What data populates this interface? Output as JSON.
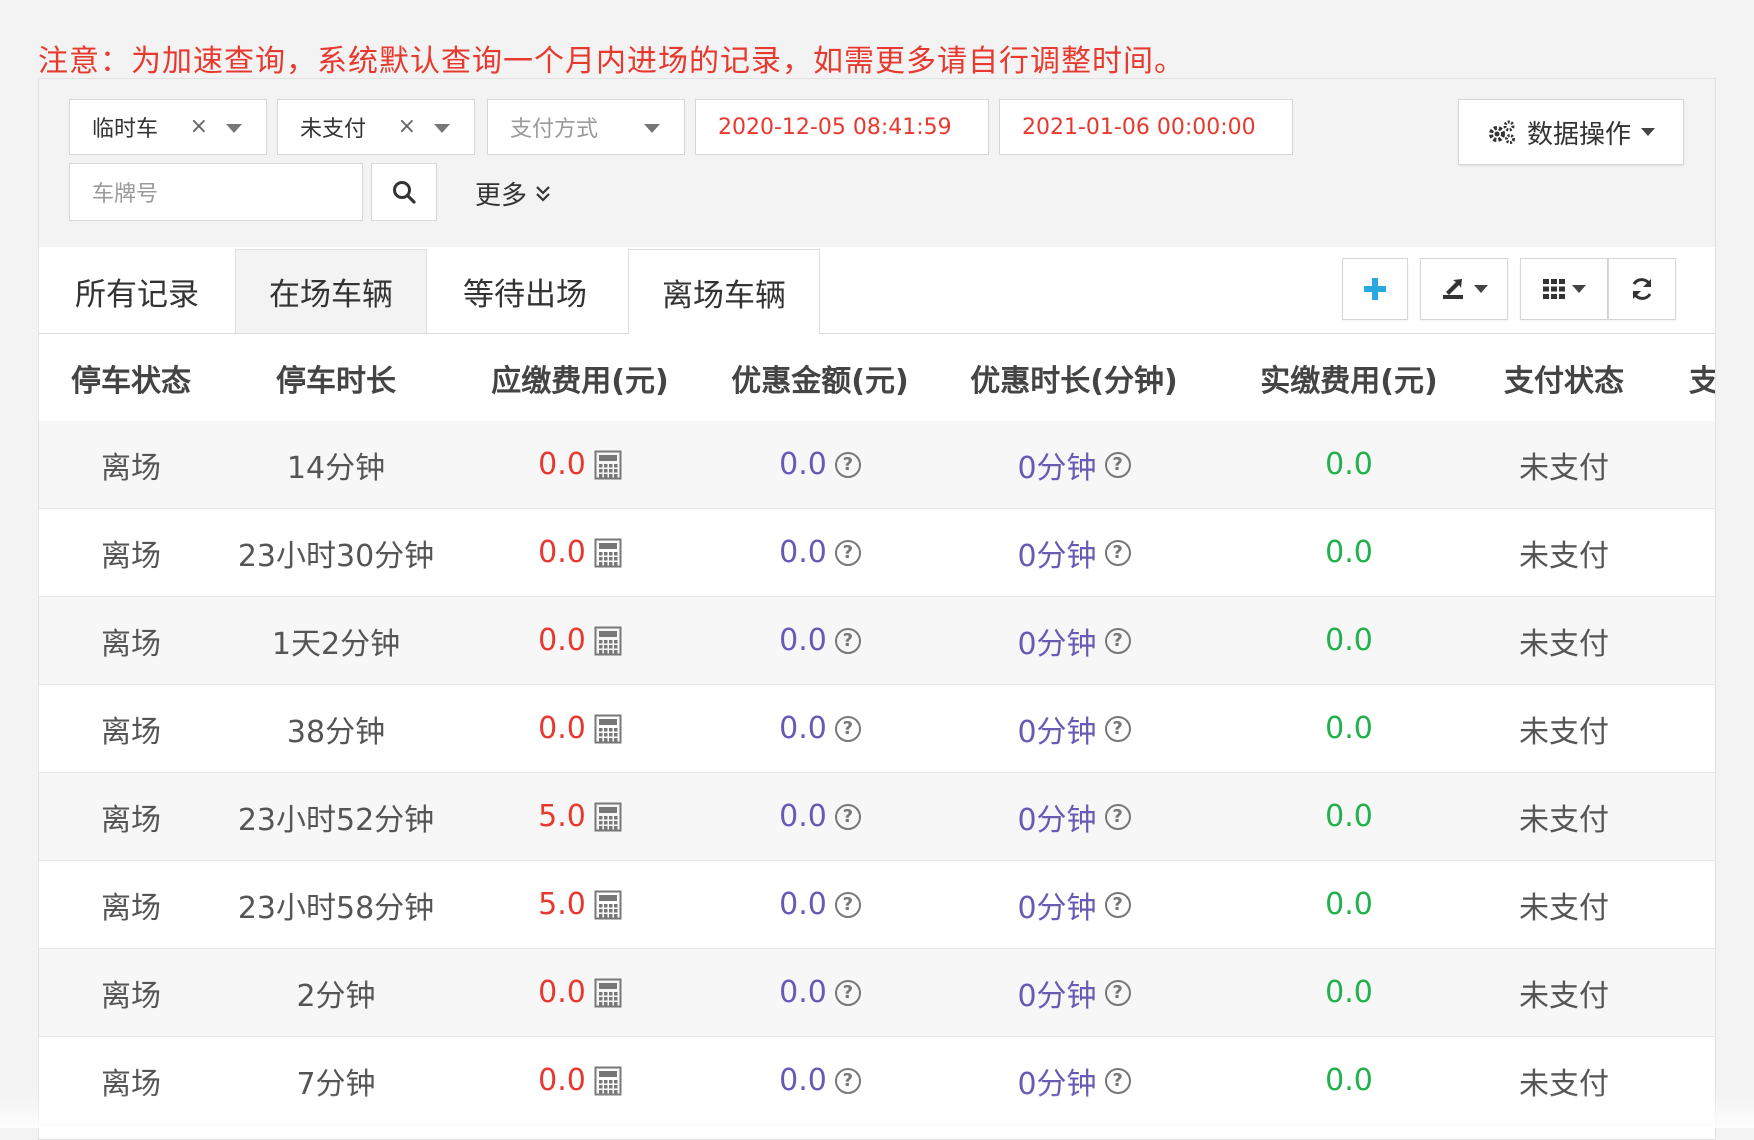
{
  "notice": "注意：为加速查询，系统默认查询一个月内进场的记录，如需更多请自行调整时间。",
  "filters": {
    "car_type": {
      "value": "临时车",
      "clear": "×"
    },
    "pay_status": {
      "value": "未支付",
      "clear": "×"
    },
    "pay_method": {
      "placeholder": "支付方式"
    },
    "start_time": "2020-12-05 08:41:59",
    "end_time": "2021-01-06 00:00:00",
    "plate_placeholder": "车牌号",
    "more_label": "更多"
  },
  "data_ops_label": "数据操作",
  "tabs": [
    "所有记录",
    "在场车辆",
    "等待出场",
    "离场车辆"
  ],
  "columns": [
    "停车状态",
    "停车时长",
    "应缴费用(元)",
    "优惠金额(元)",
    "优惠时长(分钟)",
    "实缴费用(元)",
    "支付状态",
    "支"
  ],
  "colors": {
    "notice": "#e8392f",
    "due": "#e8392f",
    "discount": "#6a5ab5",
    "paid": "#22b14c",
    "accent_plus": "#29a9e1"
  },
  "rows": [
    {
      "status": "离场",
      "duration": "14分钟",
      "due": "0.0",
      "discount": "0.0",
      "discount_time": "0分钟",
      "paid": "0.0",
      "pay_status": "未支付"
    },
    {
      "status": "离场",
      "duration": "23小时30分钟",
      "due": "0.0",
      "discount": "0.0",
      "discount_time": "0分钟",
      "paid": "0.0",
      "pay_status": "未支付"
    },
    {
      "status": "离场",
      "duration": "1天2分钟",
      "due": "0.0",
      "discount": "0.0",
      "discount_time": "0分钟",
      "paid": "0.0",
      "pay_status": "未支付"
    },
    {
      "status": "离场",
      "duration": "38分钟",
      "due": "0.0",
      "discount": "0.0",
      "discount_time": "0分钟",
      "paid": "0.0",
      "pay_status": "未支付"
    },
    {
      "status": "离场",
      "duration": "23小时52分钟",
      "due": "5.0",
      "discount": "0.0",
      "discount_time": "0分钟",
      "paid": "0.0",
      "pay_status": "未支付"
    },
    {
      "status": "离场",
      "duration": "23小时58分钟",
      "due": "5.0",
      "discount": "0.0",
      "discount_time": "0分钟",
      "paid": "0.0",
      "pay_status": "未支付"
    },
    {
      "status": "离场",
      "duration": "2分钟",
      "due": "0.0",
      "discount": "0.0",
      "discount_time": "0分钟",
      "paid": "0.0",
      "pay_status": "未支付"
    },
    {
      "status": "离场",
      "duration": "7分钟",
      "due": "0.0",
      "discount": "0.0",
      "discount_time": "0分钟",
      "paid": "0.0",
      "pay_status": "未支付"
    }
  ]
}
